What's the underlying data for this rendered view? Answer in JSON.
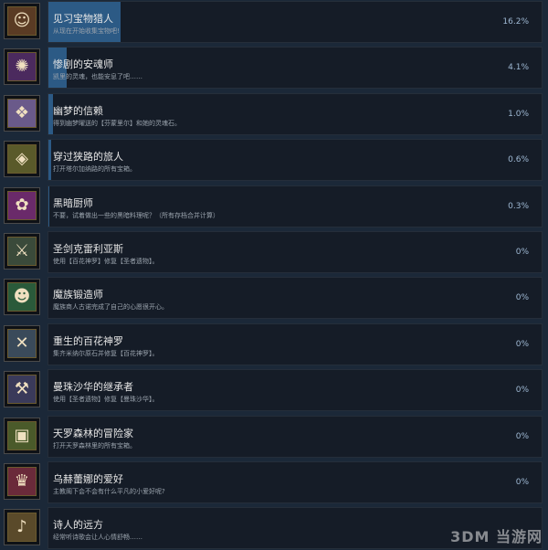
{
  "achievements": [
    {
      "title": "见习宝物猎人",
      "desc": "从现在开始收集宝物吧!",
      "percent_text": "16.2%",
      "progress": 0.162,
      "icon": "treasure-hunter-icon",
      "glyph": "☺",
      "color": "#5a3b24"
    },
    {
      "title": "惨剧的安魂师",
      "desc": "凯里的灵魂，也能安息了吧……",
      "percent_text": "4.1%",
      "progress": 0.041,
      "icon": "requiem-spirit-icon",
      "glyph": "✺",
      "color": "#4b2a5e"
    },
    {
      "title": "幽梦的信赖",
      "desc": "得到幽梦曜送的【芬蒙里尔】和她的灵魂石。",
      "percent_text": "1.0%",
      "progress": 0.01,
      "icon": "dream-trust-icon",
      "glyph": "❖",
      "color": "#6a5a8a"
    },
    {
      "title": "穿过狭路的旅人",
      "desc": "打开塔尔加纳路的所有宝箱。",
      "percent_text": "0.6%",
      "progress": 0.006,
      "icon": "traveler-chest-icon",
      "glyph": "◈",
      "color": "#5a5a2a"
    },
    {
      "title": "黑暗厨师",
      "desc": "不要，试着做出一些的黑暗料理呢？（所有存档合并计算）",
      "percent_text": "0.3%",
      "progress": 0.003,
      "icon": "dark-chef-icon",
      "glyph": "✿",
      "color": "#6a2a6a"
    },
    {
      "title": "圣剑克雷利亚斯",
      "desc": "使用【百花神罗】修复【圣者遗物】。",
      "percent_text": "0%",
      "progress": 0,
      "icon": "holy-sword-icon",
      "glyph": "⚔",
      "color": "#3a4a3a"
    },
    {
      "title": "魔族锻造师",
      "desc": "魔族商人古诺完成了自己的心愿很开心。",
      "percent_text": "0%",
      "progress": 0,
      "icon": "demon-blacksmith-icon",
      "glyph": "☻",
      "color": "#2a5a3a"
    },
    {
      "title": "重生的百花神罗",
      "desc": "集齐米纳尔原石并修复【百花神罗】。",
      "percent_text": "0%",
      "progress": 0,
      "icon": "reborn-blade-icon",
      "glyph": "✕",
      "color": "#3a4a5a"
    },
    {
      "title": "曼珠沙华的继承者",
      "desc": "使用【圣者遗物】修复【曼珠沙华】。",
      "percent_text": "0%",
      "progress": 0,
      "icon": "manjusaka-blade-icon",
      "glyph": "⚒",
      "color": "#3a3a5a"
    },
    {
      "title": "天罗森林的冒险家",
      "desc": "打开天罗森林里的所有宝箱。",
      "percent_text": "0%",
      "progress": 0,
      "icon": "forest-chest-icon",
      "glyph": "▣",
      "color": "#4a5a2a"
    },
    {
      "title": "乌赫蕾娜的爱好",
      "desc": "主教阁下会不会有什么平凡的小爱好呢?",
      "percent_text": "0%",
      "progress": 0,
      "icon": "bishop-hobby-icon",
      "glyph": "♛",
      "color": "#6a2a3a"
    },
    {
      "title": "诗人的远方",
      "desc": "经常听诗歌会让人心情舒畅……",
      "percent_text": "",
      "progress": 0,
      "icon": "poet-distance-icon",
      "glyph": "♪",
      "color": "#5a4a2a"
    }
  ],
  "watermark": "3DM 当游网"
}
